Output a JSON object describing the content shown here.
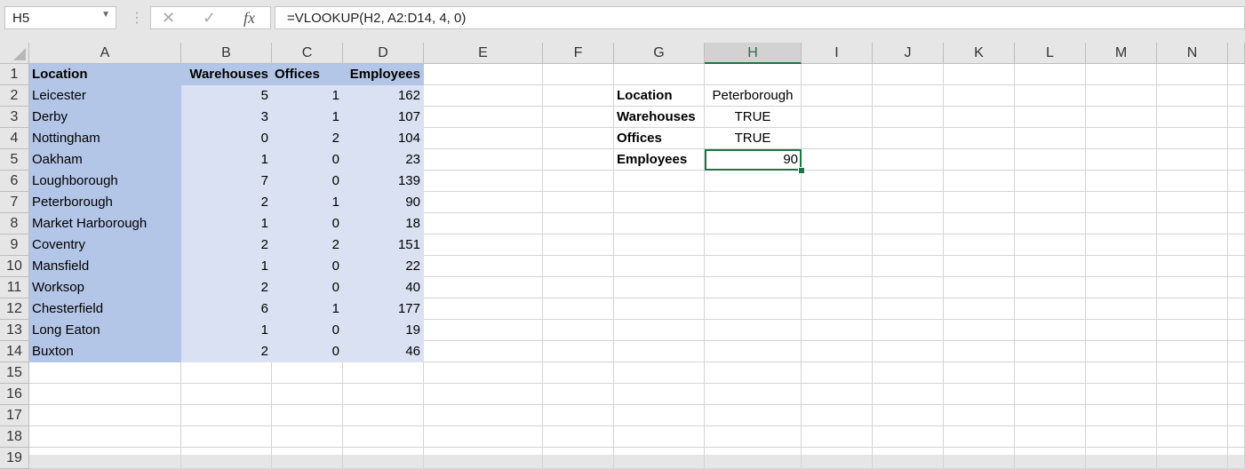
{
  "name_box": "H5",
  "formula_bar": {
    "cancel_icon": "✕",
    "enter_icon": "✓",
    "fx_label": "fx",
    "formula": "=VLOOKUP(H2, A2:D14, 4, 0)"
  },
  "columns": [
    "A",
    "B",
    "C",
    "D",
    "E",
    "F",
    "G",
    "H",
    "I",
    "J",
    "K",
    "L",
    "M",
    "N"
  ],
  "rows": [
    "1",
    "2",
    "3",
    "4",
    "5",
    "6",
    "7",
    "8",
    "9",
    "10",
    "11",
    "12",
    "13",
    "14",
    "15",
    "16",
    "17",
    "18",
    "19"
  ],
  "table": {
    "headers": [
      "Location",
      "Warehouses",
      "Offices",
      "Employees"
    ],
    "data": [
      [
        "Leicester",
        "5",
        "1",
        "162"
      ],
      [
        "Derby",
        "3",
        "1",
        "107"
      ],
      [
        "Nottingham",
        "0",
        "2",
        "104"
      ],
      [
        "Oakham",
        "1",
        "0",
        "23"
      ],
      [
        "Loughborough",
        "7",
        "0",
        "139"
      ],
      [
        "Peterborough",
        "2",
        "1",
        "90"
      ],
      [
        "Market Harborough",
        "1",
        "0",
        "18"
      ],
      [
        "Coventry",
        "2",
        "2",
        "151"
      ],
      [
        "Mansfield",
        "1",
        "0",
        "22"
      ],
      [
        "Worksop",
        "2",
        "0",
        "40"
      ],
      [
        "Chesterfield",
        "6",
        "1",
        "177"
      ],
      [
        "Long Eaton",
        "1",
        "0",
        "19"
      ],
      [
        "Buxton",
        "2",
        "0",
        "46"
      ]
    ]
  },
  "lookup": [
    {
      "label": "Location",
      "value": "Peterborough"
    },
    {
      "label": "Warehouses",
      "value": "TRUE"
    },
    {
      "label": "Offices",
      "value": "TRUE"
    },
    {
      "label": "Employees",
      "value": "90"
    }
  ],
  "colors": {
    "accent": "#217346",
    "header_fill": "#b4c6e7",
    "band_fill": "#d9e1f2"
  }
}
